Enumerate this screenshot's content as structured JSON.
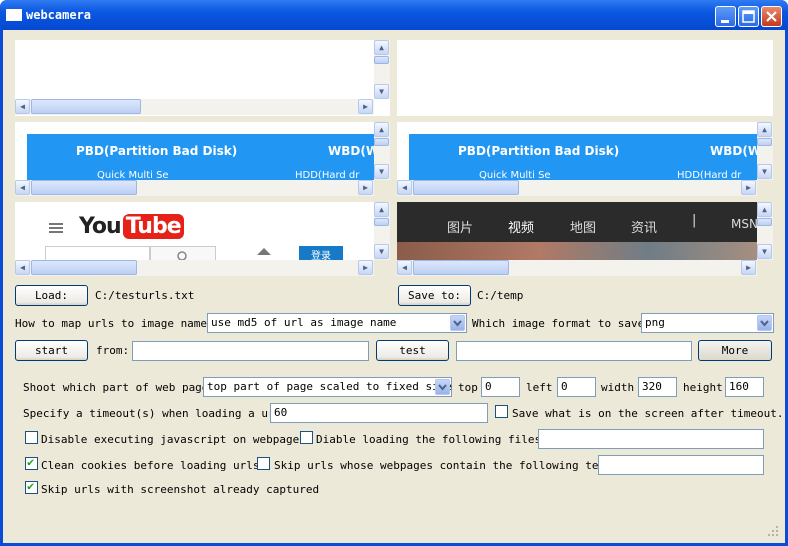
{
  "window": {
    "title": "webcamera",
    "buttons": [
      "minimize",
      "maximize",
      "close"
    ]
  },
  "previews": {
    "pane2": {
      "items": [
        "PBD(Partition Bad Disk)",
        "WBD(W",
        "Quick Multi Se",
        "HDD(Hard dr"
      ]
    },
    "pane3": {
      "items": [
        "PBD(Partition Bad Disk)",
        "WBD(W",
        "Quick Multi Se",
        "HDD(Hard dr"
      ]
    },
    "pane4": {
      "logo_you": "You",
      "logo_tube": "Tube",
      "signin": "登录"
    },
    "pane5": {
      "nav": [
        "图片",
        "视频",
        "地图",
        "资讯",
        "|",
        "MSN"
      ]
    }
  },
  "controls": {
    "load_label": "Load:",
    "load_path": "C:/testurls.txt",
    "save_label": "Save to:",
    "save_path": "C:/temp",
    "map_label": "How to map urls to image names?",
    "map_value": "use md5 of url as image name",
    "format_label": "Which image format to save?",
    "format_value": "png",
    "start_label": "start",
    "from_label": "from:",
    "from_value": "",
    "test_label": "test",
    "test_value": "",
    "more_label": "More",
    "shoot_label": "Shoot which part of web page?",
    "shoot_value": "top part of page scaled to fixed size",
    "top_label": "top",
    "top_value": "0",
    "left_label": "left",
    "left_value": "0",
    "width_label": "width",
    "width_value": "320",
    "height_label": "height",
    "height_value": "160",
    "timeout_label": "Specify a timeout(s) when loading a url:",
    "timeout_value": "60",
    "save_screen_label": "Save what is on the screen after timeout.",
    "save_screen_checked": false,
    "disable_js_label": "Disable executing javascript on webpages.",
    "disable_js_checked": false,
    "disable_files_label": "Diable loading the following files.",
    "disable_files_checked": false,
    "disable_files_value": "",
    "clean_cookies_label": "Clean cookies before loading urls.",
    "clean_cookies_checked": true,
    "skip_text_label": "Skip urls whose webpages contain the following text:",
    "skip_text_checked": false,
    "skip_text_value": "",
    "skip_captured_label": "Skip urls with screenshot already captured",
    "skip_captured_checked": true
  },
  "colors": {
    "titlebar": "#0b58e0",
    "client": "#ece9d8",
    "banner": "#2196f3",
    "youtube_red": "#e62117",
    "dark_nav": "#2b2b2b"
  }
}
